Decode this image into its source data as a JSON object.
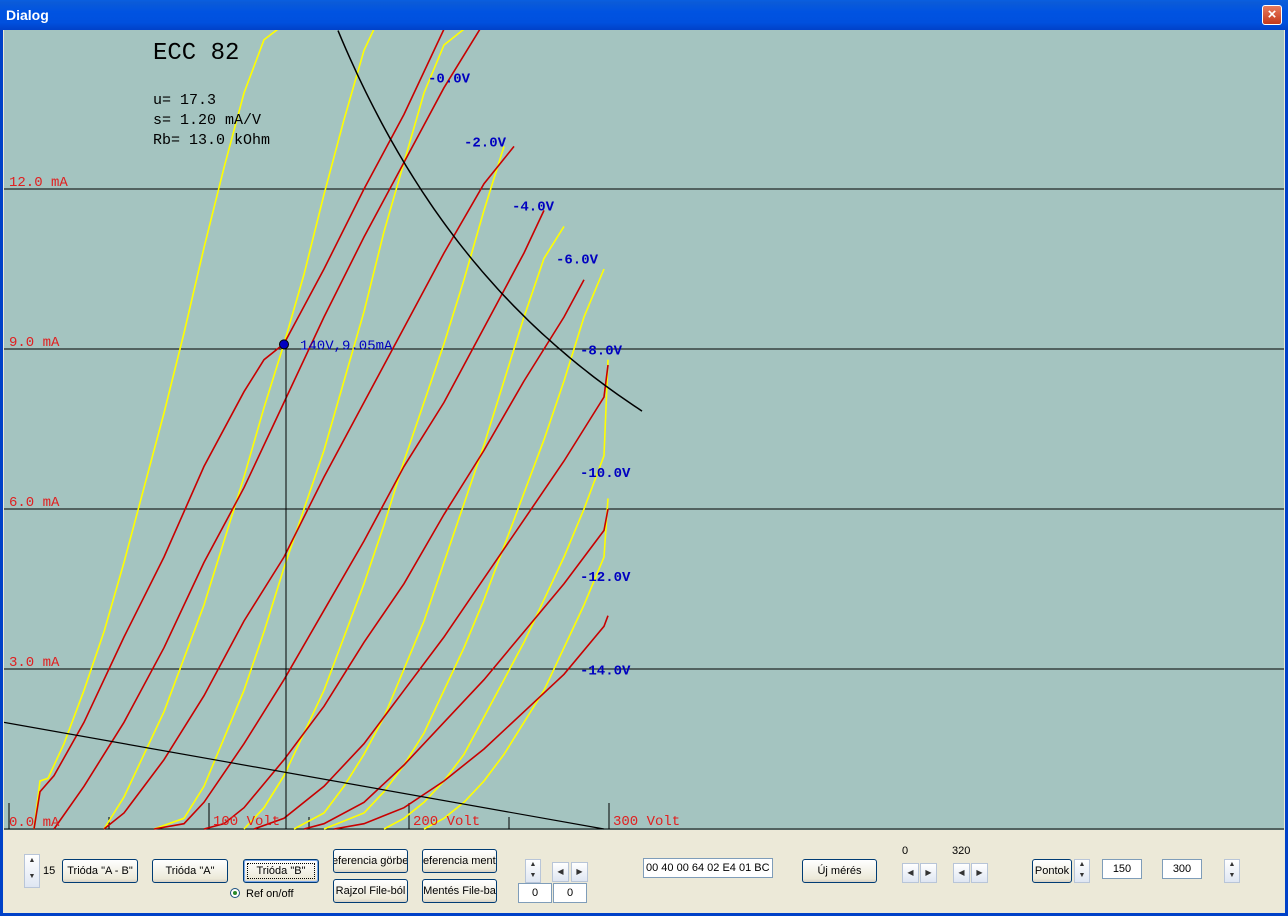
{
  "window": {
    "title": "Dialog",
    "close_symbol": "×"
  },
  "tube": {
    "name": "ECC 82",
    "mu": "u= 17.3",
    "transconductance": "s= 1.20 mA/V",
    "plate_resistance": "Rb= 13.0 kOhm"
  },
  "marker": {
    "label": "140V,9.05mA",
    "voltage": 140,
    "current": 9.05
  },
  "colors": {
    "plot_bg": "#a4c4c0",
    "measured": "#ffff00",
    "reference": "#c80000",
    "grid": "#000000",
    "grid_label": "#e02020",
    "bias_label": "#0000c0"
  },
  "chart_data": {
    "type": "line",
    "xlim": [
      0,
      320
    ],
    "ylim": [
      0,
      15
    ],
    "xlabel": "",
    "ylabel": "",
    "title": "",
    "x_ticks": [
      {
        "value": 0,
        "label": ""
      },
      {
        "value": 100,
        "label": "100 Volt"
      },
      {
        "value": 200,
        "label": "200 Volt"
      },
      {
        "value": 300,
        "label": "300 Volt"
      }
    ],
    "x_minor": [
      50,
      150,
      250
    ],
    "y_ticks": [
      {
        "value": 0,
        "label": "0.0 mA"
      },
      {
        "value": 3,
        "label": "3.0 mA"
      },
      {
        "value": 6,
        "label": "6.0 mA"
      },
      {
        "value": 9,
        "label": "9.0 mA"
      },
      {
        "value": 12,
        "label": "12.0 mA"
      }
    ],
    "bias_labels": [
      {
        "text": "-0.0V",
        "v": 212,
        "i": 14.0
      },
      {
        "text": "-2.0V",
        "v": 230,
        "i": 12.8
      },
      {
        "text": "-4.0V",
        "v": 254,
        "i": 11.6
      },
      {
        "text": "-6.0V",
        "v": 276,
        "i": 10.6
      },
      {
        "text": "-8.0V",
        "v": 288,
        "i": 8.9
      },
      {
        "text": "-10.0V",
        "v": 288,
        "i": 6.6
      },
      {
        "text": "-12.0V",
        "v": 288,
        "i": 4.65
      },
      {
        "text": "-14.0V",
        "v": 288,
        "i": 2.9
      }
    ],
    "series": [
      {
        "role": "measured",
        "points": [
          [
            15,
            0
          ],
          [
            18,
            0.9
          ],
          [
            22,
            0.95
          ],
          [
            30,
            1.6
          ],
          [
            40,
            2.6
          ],
          [
            50,
            3.7
          ],
          [
            60,
            5.0
          ],
          [
            70,
            6.4
          ],
          [
            80,
            7.8
          ],
          [
            90,
            9.3
          ],
          [
            100,
            10.9
          ],
          [
            110,
            12.4
          ],
          [
            120,
            13.8
          ],
          [
            130,
            14.8
          ],
          [
            137,
            15.0
          ]
        ]
      },
      {
        "role": "measured",
        "points": [
          [
            50,
            0
          ],
          [
            60,
            0.6
          ],
          [
            80,
            2.2
          ],
          [
            100,
            4.2
          ],
          [
            110,
            5.4
          ],
          [
            120,
            6.6
          ],
          [
            130,
            7.9
          ],
          [
            140,
            9.1
          ],
          [
            150,
            10.4
          ],
          [
            160,
            11.9
          ],
          [
            170,
            13.3
          ],
          [
            180,
            14.6
          ],
          [
            185,
            15.0
          ]
        ]
      },
      {
        "role": "measured",
        "points": [
          [
            75,
            0
          ],
          [
            90,
            0.2
          ],
          [
            100,
            0.8
          ],
          [
            110,
            1.7
          ],
          [
            120,
            2.6
          ],
          [
            130,
            3.7
          ],
          [
            140,
            4.9
          ],
          [
            150,
            6.0
          ],
          [
            160,
            7.1
          ],
          [
            170,
            8.4
          ],
          [
            180,
            9.7
          ],
          [
            190,
            11.2
          ],
          [
            200,
            12.5
          ],
          [
            210,
            13.8
          ],
          [
            220,
            14.7
          ],
          [
            230,
            15.0
          ]
        ]
      },
      {
        "role": "measured",
        "points": [
          [
            120,
            0
          ],
          [
            130,
            0.4
          ],
          [
            140,
            1.0
          ],
          [
            150,
            1.8
          ],
          [
            160,
            2.6
          ],
          [
            170,
            3.6
          ],
          [
            180,
            4.6
          ],
          [
            190,
            5.7
          ],
          [
            200,
            6.9
          ],
          [
            210,
            8.0
          ],
          [
            220,
            9.1
          ],
          [
            230,
            10.3
          ],
          [
            240,
            11.6
          ],
          [
            250,
            12.8
          ]
        ]
      },
      {
        "role": "measured",
        "points": [
          [
            145,
            0
          ],
          [
            160,
            0.3
          ],
          [
            170,
            0.8
          ],
          [
            180,
            1.4
          ],
          [
            190,
            2.1
          ],
          [
            200,
            3.0
          ],
          [
            210,
            3.9
          ],
          [
            220,
            5.0
          ],
          [
            230,
            6.1
          ],
          [
            240,
            7.2
          ],
          [
            250,
            8.4
          ],
          [
            260,
            9.6
          ],
          [
            270,
            10.7
          ],
          [
            280,
            11.3
          ]
        ]
      },
      {
        "role": "measured",
        "points": [
          [
            160,
            0
          ],
          [
            180,
            0.3
          ],
          [
            190,
            0.7
          ],
          [
            200,
            1.2
          ],
          [
            210,
            1.8
          ],
          [
            220,
            2.6
          ],
          [
            230,
            3.4
          ],
          [
            240,
            4.3
          ],
          [
            250,
            5.3
          ],
          [
            260,
            6.3
          ],
          [
            270,
            7.3
          ],
          [
            280,
            8.4
          ],
          [
            290,
            9.6
          ],
          [
            300,
            10.5
          ]
        ]
      },
      {
        "role": "measured",
        "points": [
          [
            190,
            0
          ],
          [
            200,
            0.2
          ],
          [
            210,
            0.5
          ],
          [
            220,
            0.9
          ],
          [
            230,
            1.4
          ],
          [
            240,
            2.1
          ],
          [
            250,
            2.8
          ],
          [
            260,
            3.5
          ],
          [
            270,
            4.3
          ],
          [
            280,
            5.1
          ],
          [
            290,
            6.0
          ],
          [
            300,
            7.0
          ],
          [
            302,
            8.8
          ]
        ]
      },
      {
        "role": "measured",
        "points": [
          [
            210,
            0
          ],
          [
            220,
            0.2
          ],
          [
            230,
            0.5
          ],
          [
            240,
            0.9
          ],
          [
            250,
            1.4
          ],
          [
            260,
            2.0
          ],
          [
            270,
            2.6
          ],
          [
            280,
            3.4
          ],
          [
            290,
            4.2
          ],
          [
            300,
            5.1
          ],
          [
            302,
            6.2
          ]
        ]
      },
      {
        "role": "reference",
        "points": [
          [
            15,
            0
          ],
          [
            18,
            0.7
          ],
          [
            25,
            1.0
          ],
          [
            40,
            2.0
          ],
          [
            60,
            3.6
          ],
          [
            80,
            5.1
          ],
          [
            100,
            6.8
          ],
          [
            120,
            8.2
          ],
          [
            130,
            8.8
          ],
          [
            140,
            9.1
          ],
          [
            160,
            10.5
          ],
          [
            180,
            12.0
          ],
          [
            200,
            13.4
          ],
          [
            220,
            15.0
          ]
        ]
      },
      {
        "role": "reference",
        "points": [
          [
            25,
            0
          ],
          [
            40,
            0.8
          ],
          [
            60,
            2.0
          ],
          [
            80,
            3.4
          ],
          [
            100,
            5.0
          ],
          [
            120,
            6.4
          ],
          [
            140,
            8.0
          ],
          [
            160,
            9.6
          ],
          [
            180,
            11.1
          ],
          [
            200,
            12.5
          ],
          [
            220,
            13.9
          ],
          [
            238,
            15.0
          ]
        ]
      },
      {
        "role": "reference",
        "points": [
          [
            50,
            0
          ],
          [
            60,
            0.3
          ],
          [
            80,
            1.3
          ],
          [
            100,
            2.5
          ],
          [
            120,
            3.9
          ],
          [
            140,
            5.1
          ],
          [
            160,
            6.6
          ],
          [
            180,
            8.0
          ],
          [
            200,
            9.4
          ],
          [
            220,
            10.8
          ],
          [
            240,
            12.1
          ],
          [
            255,
            12.8
          ]
        ]
      },
      {
        "role": "reference",
        "points": [
          [
            75,
            0
          ],
          [
            90,
            0.1
          ],
          [
            100,
            0.5
          ],
          [
            120,
            1.6
          ],
          [
            140,
            2.8
          ],
          [
            160,
            4.1
          ],
          [
            180,
            5.4
          ],
          [
            200,
            6.8
          ],
          [
            220,
            8.0
          ],
          [
            240,
            9.4
          ],
          [
            260,
            10.8
          ],
          [
            270,
            11.6
          ]
        ]
      },
      {
        "role": "reference",
        "points": [
          [
            100,
            0
          ],
          [
            110,
            0.1
          ],
          [
            120,
            0.4
          ],
          [
            140,
            1.3
          ],
          [
            160,
            2.3
          ],
          [
            180,
            3.5
          ],
          [
            200,
            4.6
          ],
          [
            220,
            5.9
          ],
          [
            240,
            7.1
          ],
          [
            260,
            8.4
          ],
          [
            280,
            9.6
          ],
          [
            290,
            10.3
          ]
        ]
      },
      {
        "role": "reference",
        "points": [
          [
            125,
            0
          ],
          [
            140,
            0.2
          ],
          [
            160,
            0.8
          ],
          [
            180,
            1.6
          ],
          [
            200,
            2.6
          ],
          [
            220,
            3.6
          ],
          [
            240,
            4.7
          ],
          [
            260,
            5.8
          ],
          [
            280,
            6.9
          ],
          [
            300,
            8.1
          ],
          [
            302,
            8.7
          ]
        ]
      },
      {
        "role": "reference",
        "points": [
          [
            150,
            0
          ],
          [
            160,
            0.1
          ],
          [
            180,
            0.5
          ],
          [
            200,
            1.2
          ],
          [
            220,
            2.0
          ],
          [
            240,
            2.8
          ],
          [
            260,
            3.7
          ],
          [
            280,
            4.6
          ],
          [
            300,
            5.6
          ],
          [
            302,
            6.0
          ]
        ]
      },
      {
        "role": "reference",
        "points": [
          [
            165,
            0
          ],
          [
            180,
            0.1
          ],
          [
            200,
            0.4
          ],
          [
            220,
            0.9
          ],
          [
            240,
            1.5
          ],
          [
            260,
            2.2
          ],
          [
            280,
            2.9
          ],
          [
            300,
            3.8
          ],
          [
            302,
            4.0
          ]
        ]
      }
    ],
    "load_line": {
      "points": [
        [
          0,
          2.0
        ],
        [
          300,
          0
        ]
      ]
    },
    "power_hyperbola": {
      "watts": 2.5,
      "v_from": 167,
      "v_to": 320
    }
  },
  "toolbar": {
    "spinner_value": "15",
    "btn_trioda_ab": "Trióda \"A - B\"",
    "btn_trioda_a": "Trióda  \"A\"",
    "btn_trioda_b": "Trióda  \"B\"",
    "btn_ref_curve": "Referencia görbe",
    "btn_ref_save": "Referencia mentés",
    "btn_draw_file": "Rajzol File-ból",
    "btn_save_file": "Mentés File-ba",
    "ref_toggle_label": "Ref on/off",
    "field_left": "0",
    "field_right": "0",
    "hex_bytes": "00 40 00 64 02 E4 01 BC",
    "btn_new_measure": "Új mérés",
    "range_min_label": "0",
    "range_max_label": "320",
    "btn_points": "Pontok",
    "field_150": "150",
    "field_300": "300"
  }
}
